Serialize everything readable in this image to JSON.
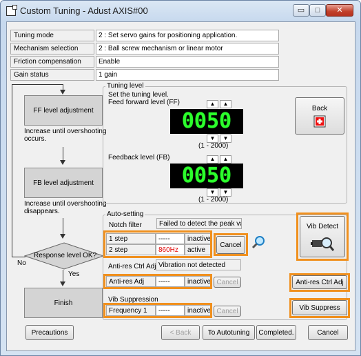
{
  "window": {
    "title": "Custom Tuning - Adust AXIS#00",
    "min_glyph": "▭",
    "max_glyph": "□",
    "close_glyph": "✕"
  },
  "info": [
    {
      "label": "Tuning mode",
      "value": "2 : Set servo gains for positioning application."
    },
    {
      "label": "Mechanism selection",
      "value": "2 : Ball screw mechanism or linear motor"
    },
    {
      "label": "Friction compensation",
      "value": "Enable"
    },
    {
      "label": "Gain status",
      "value": "1 gain"
    }
  ],
  "flow": {
    "ff_box": "FF level adjustment",
    "ff_note": "Increase until overshooting occurs.",
    "fb_box": "FB level adjustment",
    "fb_note": "Increase until overshooting disappears.",
    "decision": "Response level OK?",
    "no": "No",
    "yes": "Yes",
    "finish": "Finish"
  },
  "tuning_level": {
    "group_title": "Tuning level",
    "instruction": "Set the tuning level.",
    "ff_label": "Feed forward level (FF)",
    "ff_value": "0050",
    "ff_range": "(1 - 2000)",
    "fb_label": "Feedback level (FB)",
    "fb_value": "0050",
    "fb_range": "(1 - 2000)",
    "up": "▲",
    "down": "▼"
  },
  "back_button": "Back",
  "auto_setting": {
    "group_title": "Auto-setting",
    "notch_label": "Notch filter",
    "notch_status": "Failed to detect the peak va",
    "step1_label": "1 step",
    "step1_value": "-----",
    "step1_state": "inactive",
    "step2_label": "2 step",
    "step2_value": "860Hz",
    "step2_state": "active",
    "cancel": "Cancel",
    "vib_detect": "Vib Detect",
    "antires_label": "Anti-res Ctrl Adj",
    "antires_status": "Vibration not detected",
    "antires_adj_label": "Anti-res Adj",
    "antires_adj_value": "-----",
    "antires_adj_state": "inactive",
    "antires_cancel": "Cancel",
    "antires_button": "Anti-res Ctrl Adj",
    "vibsup_label": "Vib Suppression",
    "freq_label": "Frequency 1",
    "freq_value": "-----",
    "freq_state": "inactive",
    "vibsup_cancel": "Cancel",
    "vibsup_button": "Vib Suppress"
  },
  "footer": {
    "precautions": "Precautions",
    "back": "< Back",
    "to_autotuning": "To Autotuning",
    "completed": "Completed.",
    "cancel": "Cancel"
  }
}
